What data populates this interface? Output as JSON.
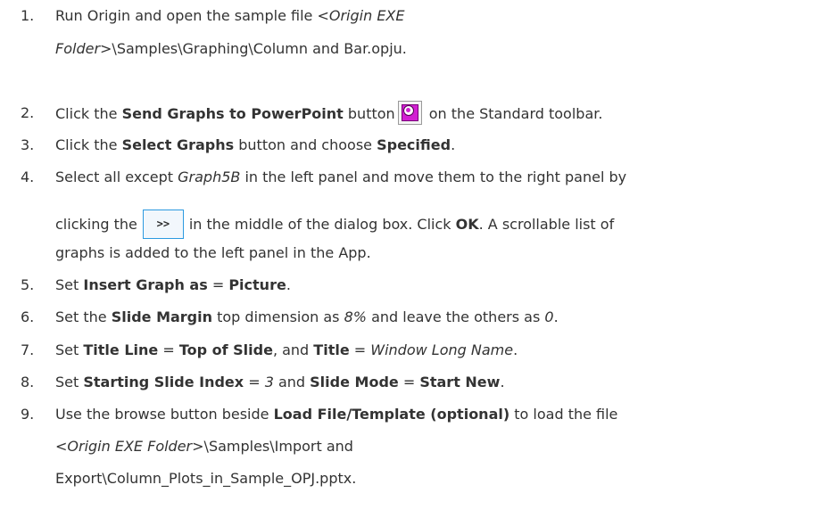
{
  "steps": [
    {
      "num": "1.",
      "line1": {
        "a": "Run Origin and open the sample file ",
        "b_italic": "<Origin EXE"
      },
      "line2": {
        "a_italic": "Folder>",
        "b": "\\Samples\\Graphing\\Column and Bar.opju."
      }
    },
    {
      "num": "2.",
      "a": "Click the ",
      "b_bold": "Send Graphs to PowerPoint",
      "c": " button",
      "icon": "send-to-powerpoint-icon",
      "d": " on the Standard toolbar."
    },
    {
      "num": "3.",
      "a": "Click the ",
      "b_bold": "Select Graphs",
      "c": " button and choose ",
      "d_bold": "Specified",
      "e": "."
    },
    {
      "num": "4.",
      "line1": {
        "a": "Select all except ",
        "b_italic": "Graph5B",
        "c": " in the left panel and move them to the right panel by"
      },
      "line2": {
        "a": "clicking the",
        "button_label": ">>",
        "b": "in the middle of the dialog box. Click ",
        "c_bold": "OK",
        "d": ". A scrollable list of"
      },
      "line3": "graphs is added to the left panel in the App."
    },
    {
      "num": "5.",
      "a": "Set ",
      "b_bold": "Insert Graph as",
      "c": " = ",
      "d_bold": "Picture",
      "e": "."
    },
    {
      "num": "6.",
      "a": "Set the ",
      "b_bold": "Slide Margin",
      "c": " top dimension as ",
      "d_italic": "8%",
      "e": " and leave the others as ",
      "f_italic": "0",
      "g": "."
    },
    {
      "num": "7.",
      "a": "Set ",
      "b_bold": "Title Line",
      "c": " = ",
      "d_bold": "Top of Slide",
      "e": ", and ",
      "f_bold": "Title",
      "g": " = ",
      "h_italic": "Window Long Name",
      "i": "."
    },
    {
      "num": "8.",
      "a": "Set ",
      "b_bold": "Starting Slide Index",
      "c": " = ",
      "d_italic": "3",
      "e": " and ",
      "f_bold": "Slide Mode",
      "g": " = ",
      "h_bold": "Start New",
      "i": "."
    },
    {
      "num": "9.",
      "line1": {
        "a": "Use the browse button beside ",
        "b_bold": "Load File/Template (optional)",
        "c": " to load the file"
      },
      "line2": {
        "a_italic": "<Origin EXE Folder>",
        "b": "\\Samples\\Import and"
      },
      "line3": "Export\\Column_Plots_in_Sample_OPJ.pptx."
    }
  ]
}
